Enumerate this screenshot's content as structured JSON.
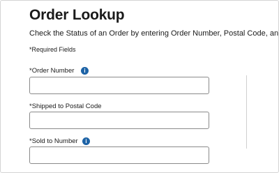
{
  "page": {
    "title": "Order Lookup",
    "subtitle": "Check the Status of an Order by entering Order Number, Postal Code, and Sold to",
    "required_note": "*Required Fields"
  },
  "fields": [
    {
      "label": "*Order Number",
      "value": "",
      "has_info_icon": true
    },
    {
      "label": "*Shipped to Postal Code",
      "value": "",
      "has_info_icon": false
    },
    {
      "label": "*Sold to Number",
      "value": "",
      "has_info_icon": true
    }
  ],
  "icons": {
    "info": "info-icon",
    "info_glyph": "i"
  },
  "colors": {
    "info_icon": "#1d63a6",
    "input_border": "#8a8a8a",
    "text": "#1a1a1a"
  }
}
